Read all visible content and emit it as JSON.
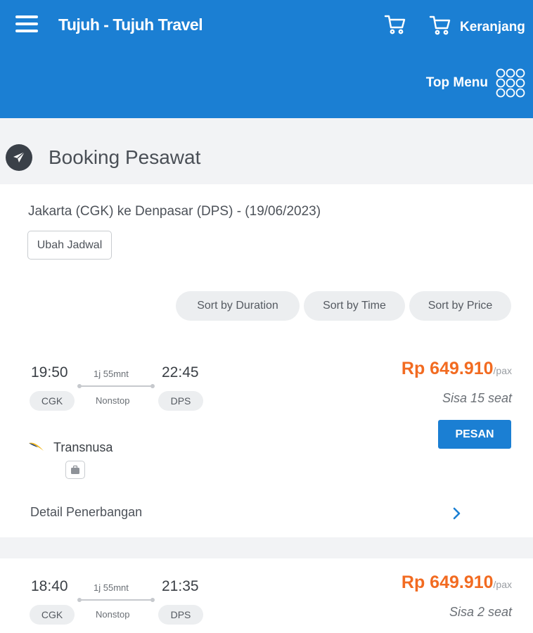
{
  "header": {
    "brand": "Tujuh - Tujuh Travel",
    "cart_label": "Keranjang",
    "top_menu_label": "Top Menu",
    "background_color": "#1b7fd3"
  },
  "page": {
    "title": "Booking Pesawat",
    "icon": "paper-plane-icon"
  },
  "search": {
    "route": "Jakarta (CGK) ke Denpasar (DPS) - (19/06/2023)",
    "change_schedule_label": "Ubah Jadwal"
  },
  "sort": {
    "duration": "Sort by Duration",
    "time": "Sort by Time",
    "price": "Sort by Price"
  },
  "flights": [
    {
      "depart_time": "19:50",
      "arrive_time": "22:45",
      "duration": "1j 55mnt",
      "stops": "Nonstop",
      "origin": "CGK",
      "destination": "DPS",
      "price": "Rp 649.910",
      "price_unit": "/pax",
      "seats": "Sisa 15 seat",
      "book_label": "PESAN",
      "airline": "Transnusa",
      "detail_label": "Detail Penerbangan"
    },
    {
      "depart_time": "18:40",
      "arrive_time": "21:35",
      "duration": "1j 55mnt",
      "stops": "Nonstop",
      "origin": "CGK",
      "destination": "DPS",
      "price": "Rp 649.910",
      "price_unit": "/pax",
      "seats": "Sisa 2 seat"
    }
  ],
  "colors": {
    "accent": "#1b7fd3",
    "price": "#f26b21"
  }
}
